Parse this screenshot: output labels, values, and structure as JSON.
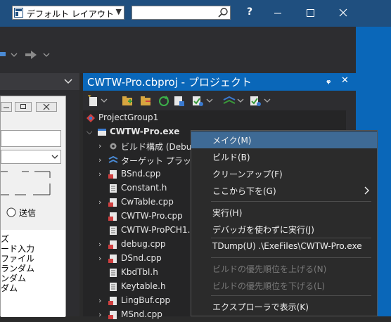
{
  "titlebar": {
    "layout_select": "デフォルト レイアウト",
    "help_label": "?",
    "icons": [
      "layout-icon",
      "chevron-down-icon",
      "search-icon",
      "minimize-icon",
      "maximize-icon",
      "close-icon"
    ]
  },
  "left_panel": {
    "radio_label": "送信",
    "list_items": [
      "ズ",
      "ード入力",
      "ファイル",
      "ランダム",
      "ンダム",
      "ダム"
    ]
  },
  "project_manager": {
    "title": "CWTW-Pro.cbproj - プロジェクト",
    "pin_label": "ᵩ",
    "close_label": "✕",
    "tree": [
      {
        "label": "ProjectGroup1",
        "icon": "project-group-icon"
      },
      {
        "label": "CWTW-Pro.exe",
        "icon": "exe-project-icon"
      },
      {
        "label": "ビルド構成 (Debug",
        "icon": "gear-icon"
      },
      {
        "label": "ターゲット プラットフ",
        "icon": "platform-icon"
      },
      {
        "label": "BSnd.cpp",
        "icon": "cpp-file-icon"
      },
      {
        "label": "Constant.h",
        "icon": "header-file-icon"
      },
      {
        "label": "CwTable.cpp",
        "icon": "cpp-file-icon"
      },
      {
        "label": "CWTW-Pro.cpp",
        "icon": "cpp-file-icon"
      },
      {
        "label": "CWTW-ProPCH1.h",
        "icon": "header-file-icon"
      },
      {
        "label": "debug.cpp",
        "icon": "cpp-file-icon"
      },
      {
        "label": "DSnd.cpp",
        "icon": "cpp-file-icon"
      },
      {
        "label": "KbdTbl.h",
        "icon": "header-file-icon"
      },
      {
        "label": "Keytable.h",
        "icon": "header-file-icon"
      },
      {
        "label": "LingBuf.cpp",
        "icon": "cpp-file-icon"
      },
      {
        "label": "MSnd.cpp",
        "icon": "cpp-file-icon"
      }
    ]
  },
  "context_menu": {
    "items": [
      {
        "label": "メイク(M)",
        "enabled": true,
        "highlighted": true
      },
      {
        "label": "ビルド(B)",
        "enabled": true
      },
      {
        "label": "クリーンアップ(F)",
        "enabled": true
      },
      {
        "label": "ここから下を(G)",
        "enabled": true,
        "submenu": true
      },
      {
        "label": "実行(H)",
        "enabled": true
      },
      {
        "label": "デバッガを使わずに実行(J)",
        "enabled": true
      },
      {
        "label": "TDump(U) .\\ExeFiles\\CWTW-Pro.exe",
        "enabled": true
      },
      {
        "label": "ビルドの優先順位を上げる(N)",
        "enabled": false
      },
      {
        "label": "ビルドの優先順位を下げる(L)",
        "enabled": false
      },
      {
        "label": "エクスプローラで表示(K)",
        "enabled": true
      }
    ]
  },
  "colors": {
    "accent": "#0a67b9",
    "menu_highlight": "#3e6a95",
    "panel_bg": "#252526"
  }
}
